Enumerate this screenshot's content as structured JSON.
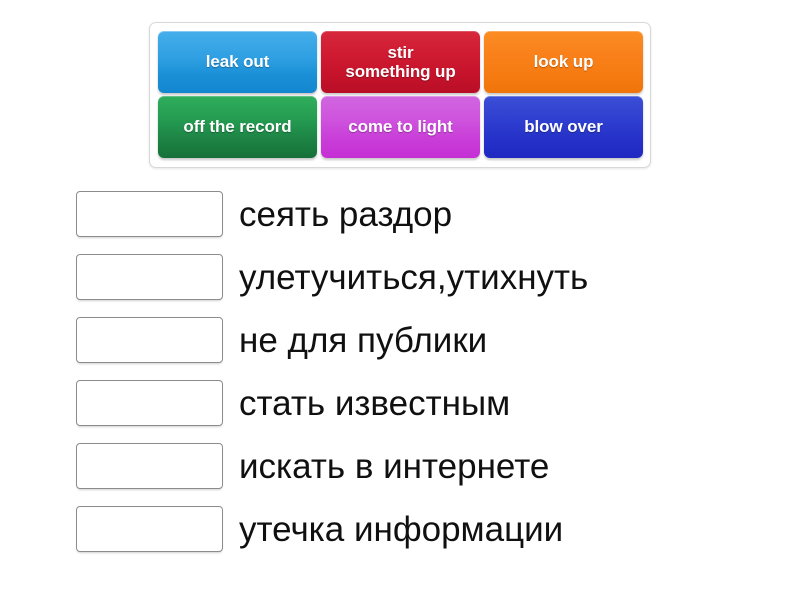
{
  "tile_tray": {
    "name": "phrase-tile-tray",
    "tiles": [
      {
        "label": "leak out",
        "color": "#2e9fe2",
        "skin": "skin-blue"
      },
      {
        "label": "stir\nsomething up",
        "color": "#cf1a31",
        "skin": "skin-red"
      },
      {
        "label": "look up",
        "color": "#f9801a",
        "skin": "skin-orange"
      },
      {
        "label": "off the record",
        "color": "#249b51",
        "skin": "skin-green"
      },
      {
        "label": "come to light",
        "color": "#ce53dd",
        "skin": "skin-magenta"
      },
      {
        "label": "blow over",
        "color": "#2f3fd0",
        "skin": "skin-indigo"
      }
    ]
  },
  "answers": [
    {
      "drop_value": "",
      "text": "сеять раздор"
    },
    {
      "drop_value": "",
      "text": "улетучиться,утихнуть"
    },
    {
      "drop_value": "",
      "text": "не для публики"
    },
    {
      "drop_value": "",
      "text": "стать известным"
    },
    {
      "drop_value": "",
      "text": "искать в интернете"
    },
    {
      "drop_value": "",
      "text": "утечка информации"
    }
  ]
}
